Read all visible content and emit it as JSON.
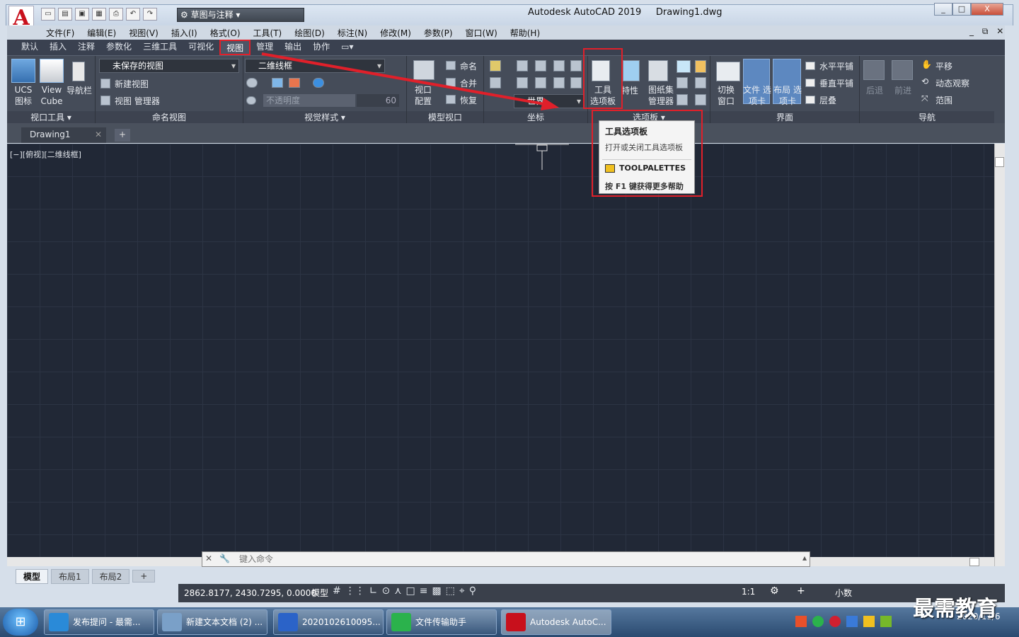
{
  "window": {
    "title": "Autodesk AutoCAD 2019",
    "file": "Drawing1.dwg",
    "logo": "A",
    "workspace": "草图与注释",
    "min": "_",
    "max": "□",
    "close": "X"
  },
  "menu": [
    "文件(F)",
    "编辑(E)",
    "视图(V)",
    "插入(I)",
    "格式(O)",
    "工具(T)",
    "绘图(D)",
    "标注(N)",
    "修改(M)",
    "参数(P)",
    "窗口(W)",
    "帮助(H)"
  ],
  "ribbon_tabs": [
    "默认",
    "插入",
    "注释",
    "参数化",
    "三维工具",
    "可视化",
    "视图",
    "管理",
    "输出",
    "协作"
  ],
  "ribbon": {
    "viewport_tools": {
      "ucs": "UCS 图标",
      "viewcube": "View Cube",
      "navbar": "导航栏",
      "title": "视口工具 ▾"
    },
    "named_views": {
      "unsaved": "未保存的视图",
      "new": "新建视图",
      "manager": "视图 管理器",
      "title": "命名视图"
    },
    "visual_styles": {
      "style": "二维线框",
      "opacity": "不透明度",
      "opacity_val": "60",
      "title": "视觉样式 ▾"
    },
    "model_viewports": {
      "config": "视口 配置",
      "name": "命名",
      "join": "合并",
      "restore": "恢复",
      "title": "模型视口"
    },
    "coords": {
      "world": "世界",
      "title": "坐标"
    },
    "palettes": {
      "tool_palettes": "工具 选项板",
      "properties": "特性",
      "sheetset": "图纸集 管理器",
      "title": "选项板 ▾"
    },
    "interface": {
      "switch": "切换 窗口",
      "filetabs": "文件 选项卡",
      "layouttabs": "布局 选项卡",
      "tile_h": "水平平铺",
      "tile_v": "垂直平铺",
      "cascade": "层叠",
      "title": "界面"
    },
    "navigate": {
      "back": "后退",
      "forward": "前进",
      "pan": "平移",
      "orbit": "动态观察",
      "extents": "范围",
      "title": "导航"
    }
  },
  "doc_tab": "Drawing1",
  "viewport_label": "[−][俯视][二维线框]",
  "tooltip": {
    "title": "工具选项板",
    "desc": "打开或关闭工具选项板",
    "command": "TOOLPALETTES",
    "help": "按 F1 键获得更多帮助"
  },
  "command_placeholder": "键入命令",
  "layout_tabs": [
    "模型",
    "布局1",
    "布局2"
  ],
  "status": {
    "coords": "2862.8177, 2430.7295, 0.0000",
    "model": "模型",
    "scale": "1:1",
    "units": "小数"
  },
  "taskbar": [
    {
      "label": "发布提问 - 最需...",
      "color": "#2a8ad8"
    },
    {
      "label": "新建文本文档 (2) ...",
      "color": "#7aa0c8"
    },
    {
      "label": "2020102610095...",
      "color": "#2b63c8"
    },
    {
      "label": "文件传输助手",
      "color": "#2bb24c"
    },
    {
      "label": "Autodesk AutoC...",
      "color": "#c8101c"
    }
  ],
  "clock": {
    "date": "2020/11/6"
  },
  "brand": "最需教育"
}
